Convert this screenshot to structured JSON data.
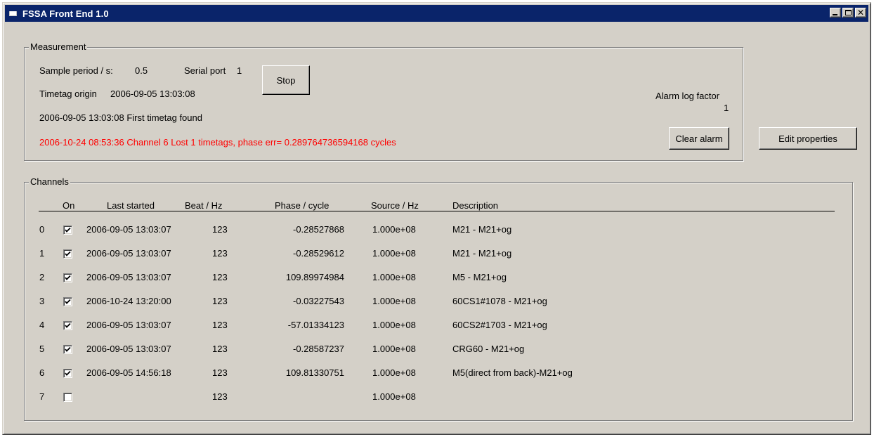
{
  "window": {
    "title": "FSSA Front End 1.0"
  },
  "measurement": {
    "legend": "Measurement",
    "sample_period_label": "Sample period / s:",
    "sample_period_value": "0.5",
    "serial_port_label": "Serial port",
    "serial_port_value": "1",
    "stop_label": "Stop",
    "timetag_origin_label": "Timetag origin",
    "timetag_origin_value": "2006-09-05 13:03:08",
    "first_timetag_text": "2006-09-05 13:03:08  First timetag found",
    "alarm_text": "2006-10-24 08:53:36 Channel 6 Lost 1 timetags, phase err= 0.289764736594168 cycles",
    "alarm_log_factor_label": "Alarm log factor",
    "alarm_log_factor_value": "1",
    "clear_alarm_label": "Clear alarm",
    "alarm_color": "#ff0000"
  },
  "edit_properties_label": "Edit properties",
  "channels": {
    "legend": "Channels",
    "headers": {
      "on": "On",
      "last_started": "Last started",
      "beat": "Beat / Hz",
      "phase": "Phase / cycle",
      "source": "Source / Hz",
      "description": "Description"
    },
    "rows": [
      {
        "index": "0",
        "on": true,
        "last_started": "2006-09-05 13:03:07",
        "beat": "123",
        "phase": "-0.28527868",
        "source": "1.000e+08",
        "description": "M21 - M21+og"
      },
      {
        "index": "1",
        "on": true,
        "last_started": "2006-09-05 13:03:07",
        "beat": "123",
        "phase": "-0.28529612",
        "source": "1.000e+08",
        "description": "M21 - M21+og"
      },
      {
        "index": "2",
        "on": true,
        "last_started": "2006-09-05 13:03:07",
        "beat": "123",
        "phase": "109.89974984",
        "source": "1.000e+08",
        "description": "M5 - M21+og"
      },
      {
        "index": "3",
        "on": true,
        "last_started": "2006-10-24 13:20:00",
        "beat": "123",
        "phase": "-0.03227543",
        "source": "1.000e+08",
        "description": "60CS1#1078  - M21+og"
      },
      {
        "index": "4",
        "on": true,
        "last_started": "2006-09-05 13:03:07",
        "beat": "123",
        "phase": "-57.01334123",
        "source": "1.000e+08",
        "description": "60CS2#1703 - M21+og"
      },
      {
        "index": "5",
        "on": true,
        "last_started": "2006-09-05 13:03:07",
        "beat": "123",
        "phase": "-0.28587237",
        "source": "1.000e+08",
        "description": "CRG60 - M21+og"
      },
      {
        "index": "6",
        "on": true,
        "last_started": "2006-09-05 14:56:18",
        "beat": "123",
        "phase": "109.81330751",
        "source": "1.000e+08",
        "description": "M5(direct from back)-M21+og"
      },
      {
        "index": "7",
        "on": false,
        "last_started": "",
        "beat": "123",
        "phase": "",
        "source": "1.000e+08",
        "description": ""
      }
    ]
  },
  "icons": {
    "app": "app-window-icon",
    "minimize": "minimize-icon",
    "maximize": "maximize-icon",
    "close": "close-icon",
    "check": "check-icon"
  }
}
